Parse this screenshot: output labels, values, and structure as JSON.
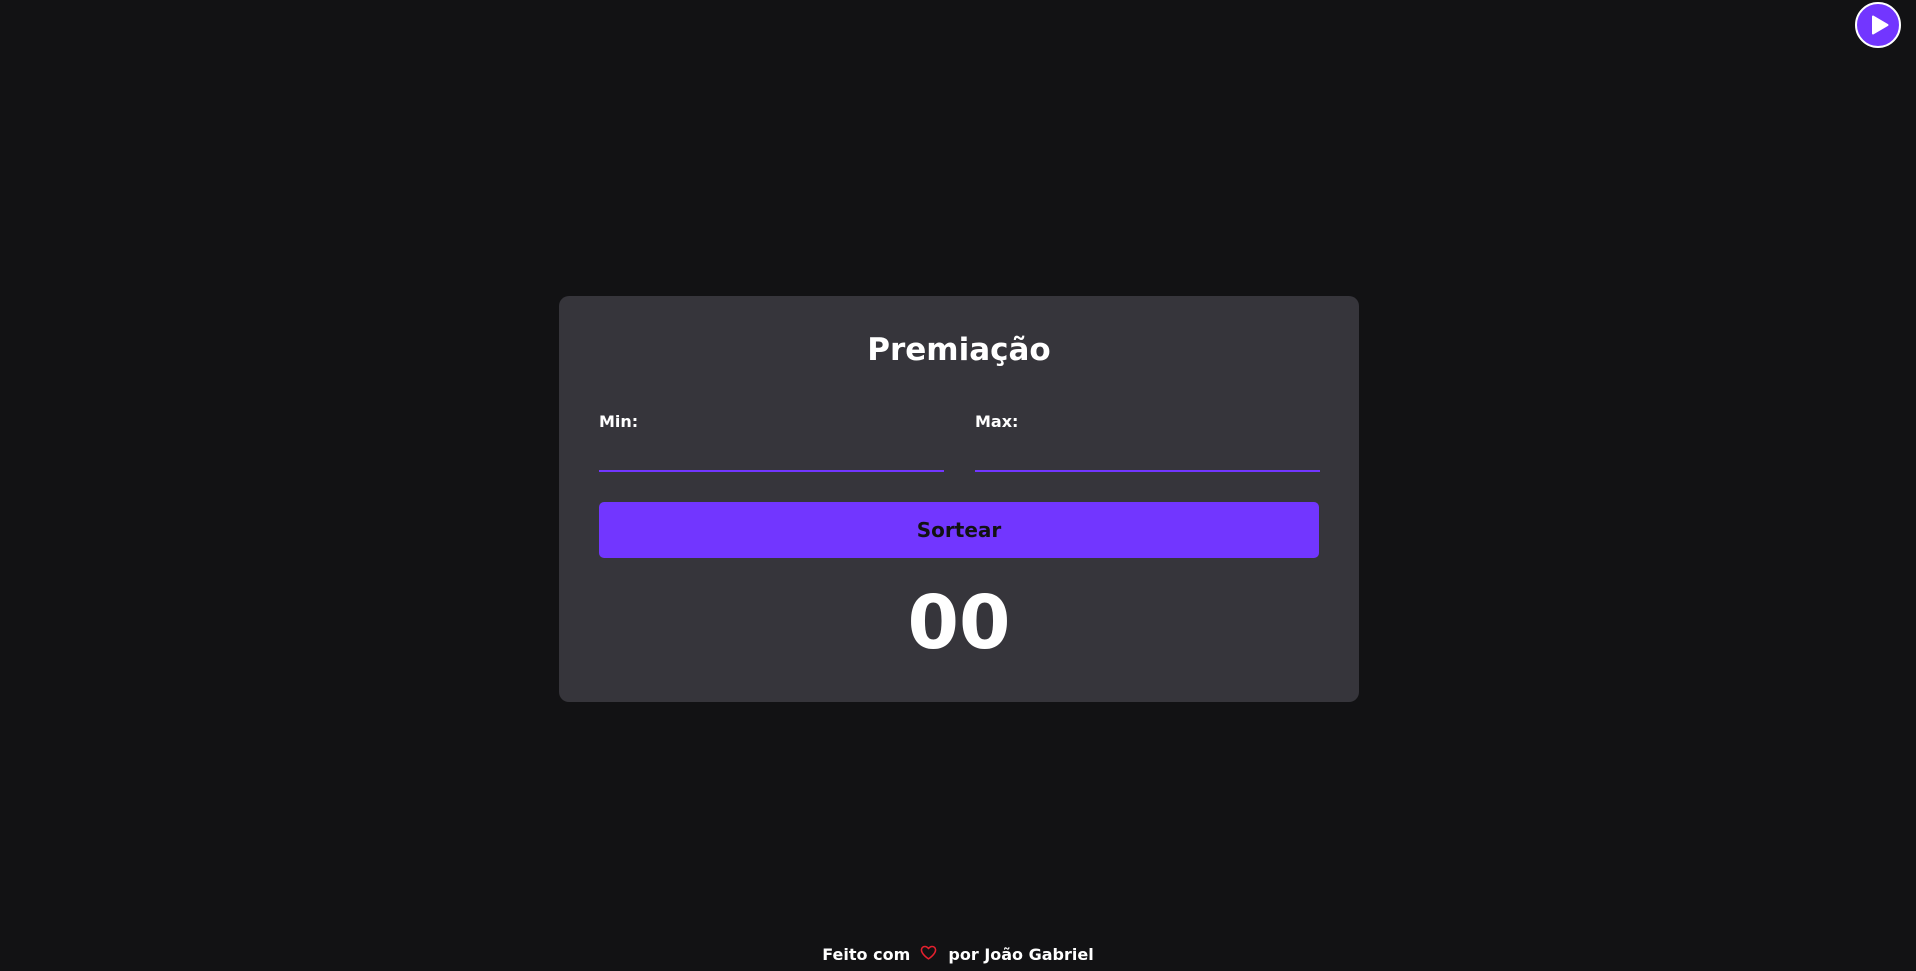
{
  "toolbar": {
    "play_icon": "play-icon",
    "accent_color": "#7236ff"
  },
  "card": {
    "title": "Premiação",
    "min": {
      "label": "Min:",
      "value": ""
    },
    "max": {
      "label": "Max:",
      "value": ""
    },
    "draw_button_label": "Sortear",
    "result": "00"
  },
  "footer": {
    "made_with": "Feito com",
    "heart_icon": "heart-icon",
    "heart_color": "#e5202e",
    "by_author": "por João Gabriel"
  },
  "colors": {
    "background": "#121214",
    "card": "#36353b",
    "accent": "#7236ff"
  }
}
